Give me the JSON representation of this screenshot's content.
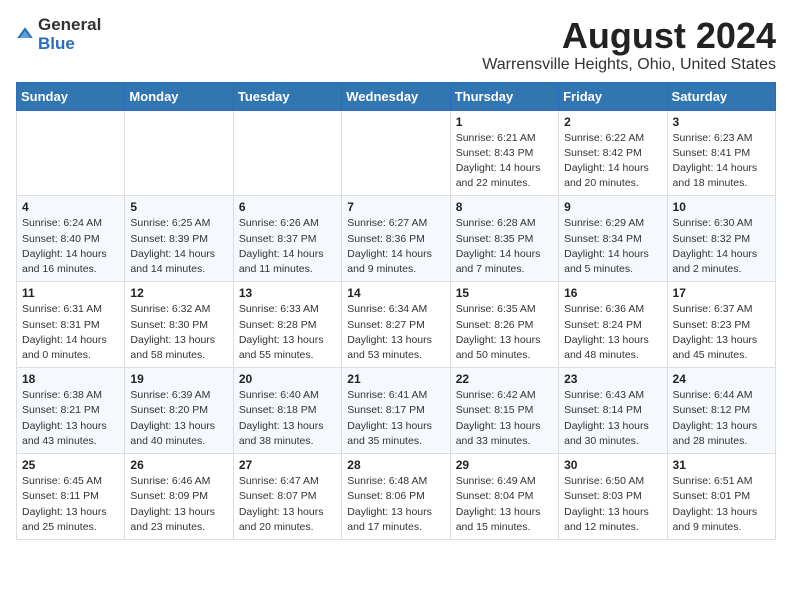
{
  "header": {
    "logo_general": "General",
    "logo_blue": "Blue",
    "month_year": "August 2024",
    "location": "Warrensville Heights, Ohio, United States"
  },
  "weekdays": [
    "Sunday",
    "Monday",
    "Tuesday",
    "Wednesday",
    "Thursday",
    "Friday",
    "Saturday"
  ],
  "weeks": [
    [
      {
        "day": "",
        "info": ""
      },
      {
        "day": "",
        "info": ""
      },
      {
        "day": "",
        "info": ""
      },
      {
        "day": "",
        "info": ""
      },
      {
        "day": "1",
        "info": "Sunrise: 6:21 AM\nSunset: 8:43 PM\nDaylight: 14 hours\nand 22 minutes."
      },
      {
        "day": "2",
        "info": "Sunrise: 6:22 AM\nSunset: 8:42 PM\nDaylight: 14 hours\nand 20 minutes."
      },
      {
        "day": "3",
        "info": "Sunrise: 6:23 AM\nSunset: 8:41 PM\nDaylight: 14 hours\nand 18 minutes."
      }
    ],
    [
      {
        "day": "4",
        "info": "Sunrise: 6:24 AM\nSunset: 8:40 PM\nDaylight: 14 hours\nand 16 minutes."
      },
      {
        "day": "5",
        "info": "Sunrise: 6:25 AM\nSunset: 8:39 PM\nDaylight: 14 hours\nand 14 minutes."
      },
      {
        "day": "6",
        "info": "Sunrise: 6:26 AM\nSunset: 8:37 PM\nDaylight: 14 hours\nand 11 minutes."
      },
      {
        "day": "7",
        "info": "Sunrise: 6:27 AM\nSunset: 8:36 PM\nDaylight: 14 hours\nand 9 minutes."
      },
      {
        "day": "8",
        "info": "Sunrise: 6:28 AM\nSunset: 8:35 PM\nDaylight: 14 hours\nand 7 minutes."
      },
      {
        "day": "9",
        "info": "Sunrise: 6:29 AM\nSunset: 8:34 PM\nDaylight: 14 hours\nand 5 minutes."
      },
      {
        "day": "10",
        "info": "Sunrise: 6:30 AM\nSunset: 8:32 PM\nDaylight: 14 hours\nand 2 minutes."
      }
    ],
    [
      {
        "day": "11",
        "info": "Sunrise: 6:31 AM\nSunset: 8:31 PM\nDaylight: 14 hours\nand 0 minutes."
      },
      {
        "day": "12",
        "info": "Sunrise: 6:32 AM\nSunset: 8:30 PM\nDaylight: 13 hours\nand 58 minutes."
      },
      {
        "day": "13",
        "info": "Sunrise: 6:33 AM\nSunset: 8:28 PM\nDaylight: 13 hours\nand 55 minutes."
      },
      {
        "day": "14",
        "info": "Sunrise: 6:34 AM\nSunset: 8:27 PM\nDaylight: 13 hours\nand 53 minutes."
      },
      {
        "day": "15",
        "info": "Sunrise: 6:35 AM\nSunset: 8:26 PM\nDaylight: 13 hours\nand 50 minutes."
      },
      {
        "day": "16",
        "info": "Sunrise: 6:36 AM\nSunset: 8:24 PM\nDaylight: 13 hours\nand 48 minutes."
      },
      {
        "day": "17",
        "info": "Sunrise: 6:37 AM\nSunset: 8:23 PM\nDaylight: 13 hours\nand 45 minutes."
      }
    ],
    [
      {
        "day": "18",
        "info": "Sunrise: 6:38 AM\nSunset: 8:21 PM\nDaylight: 13 hours\nand 43 minutes."
      },
      {
        "day": "19",
        "info": "Sunrise: 6:39 AM\nSunset: 8:20 PM\nDaylight: 13 hours\nand 40 minutes."
      },
      {
        "day": "20",
        "info": "Sunrise: 6:40 AM\nSunset: 8:18 PM\nDaylight: 13 hours\nand 38 minutes."
      },
      {
        "day": "21",
        "info": "Sunrise: 6:41 AM\nSunset: 8:17 PM\nDaylight: 13 hours\nand 35 minutes."
      },
      {
        "day": "22",
        "info": "Sunrise: 6:42 AM\nSunset: 8:15 PM\nDaylight: 13 hours\nand 33 minutes."
      },
      {
        "day": "23",
        "info": "Sunrise: 6:43 AM\nSunset: 8:14 PM\nDaylight: 13 hours\nand 30 minutes."
      },
      {
        "day": "24",
        "info": "Sunrise: 6:44 AM\nSunset: 8:12 PM\nDaylight: 13 hours\nand 28 minutes."
      }
    ],
    [
      {
        "day": "25",
        "info": "Sunrise: 6:45 AM\nSunset: 8:11 PM\nDaylight: 13 hours\nand 25 minutes."
      },
      {
        "day": "26",
        "info": "Sunrise: 6:46 AM\nSunset: 8:09 PM\nDaylight: 13 hours\nand 23 minutes."
      },
      {
        "day": "27",
        "info": "Sunrise: 6:47 AM\nSunset: 8:07 PM\nDaylight: 13 hours\nand 20 minutes."
      },
      {
        "day": "28",
        "info": "Sunrise: 6:48 AM\nSunset: 8:06 PM\nDaylight: 13 hours\nand 17 minutes."
      },
      {
        "day": "29",
        "info": "Sunrise: 6:49 AM\nSunset: 8:04 PM\nDaylight: 13 hours\nand 15 minutes."
      },
      {
        "day": "30",
        "info": "Sunrise: 6:50 AM\nSunset: 8:03 PM\nDaylight: 13 hours\nand 12 minutes."
      },
      {
        "day": "31",
        "info": "Sunrise: 6:51 AM\nSunset: 8:01 PM\nDaylight: 13 hours\nand 9 minutes."
      }
    ]
  ]
}
